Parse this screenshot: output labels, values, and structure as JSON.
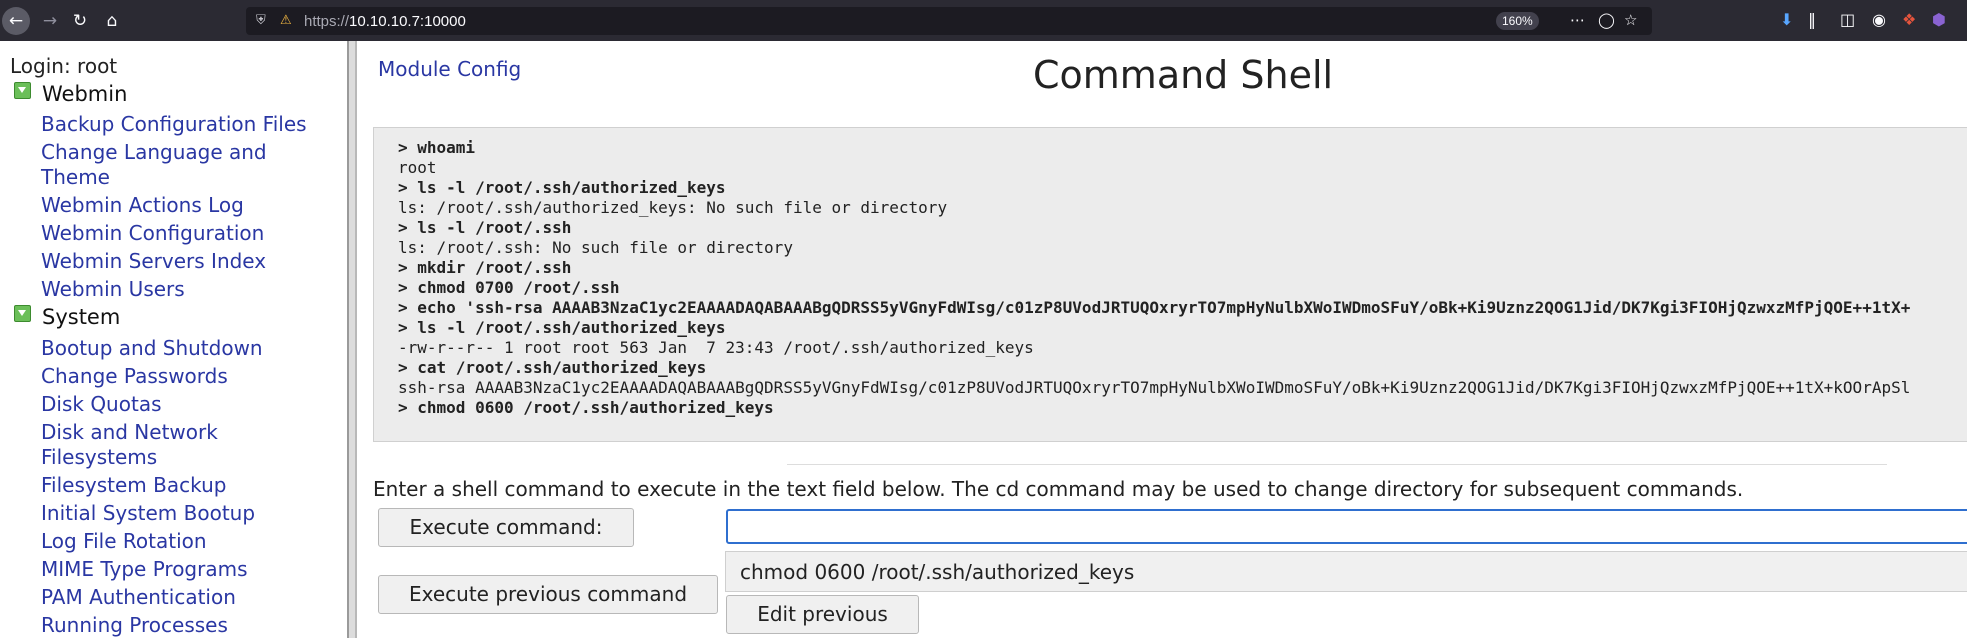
{
  "browser": {
    "url_protocol": "https://",
    "url_host": "10.10.10.7:10000",
    "zoom": "160%"
  },
  "left": {
    "login": "Login: root",
    "categories": [
      {
        "label": "Webmin",
        "items": [
          "Backup Configuration Files",
          "Change Language and Theme",
          "Webmin Actions Log",
          "Webmin Configuration",
          "Webmin Servers Index",
          "Webmin Users"
        ]
      },
      {
        "label": "System",
        "items": [
          "Bootup and Shutdown",
          "Change Passwords",
          "Disk Quotas",
          "Disk and Network Filesystems",
          "Filesystem Backup",
          "Initial System Bootup",
          "Log File Rotation",
          "MIME Type Programs",
          "PAM Authentication",
          "Running Processes"
        ]
      }
    ]
  },
  "main": {
    "module_config": "Module Config",
    "title": "Command Shell",
    "output_lines": [
      {
        "cmd": true,
        "text": "> whoami"
      },
      {
        "cmd": false,
        "text": "root"
      },
      {
        "cmd": true,
        "text": "> ls -l /root/.ssh/authorized_keys"
      },
      {
        "cmd": false,
        "text": "ls: /root/.ssh/authorized_keys: No such file or directory"
      },
      {
        "cmd": true,
        "text": "> ls -l /root/.ssh"
      },
      {
        "cmd": false,
        "text": "ls: /root/.ssh: No such file or directory"
      },
      {
        "cmd": true,
        "text": "> mkdir /root/.ssh"
      },
      {
        "cmd": true,
        "text": "> chmod 0700 /root/.ssh"
      },
      {
        "cmd": true,
        "text": "> echo 'ssh-rsa AAAAB3NzaC1yc2EAAAADAQABAAABgQDRSS5yVGnyFdWIsg/c01zP8UVodJRTUQOxryrTO7mpHyNulbXWoIWDmoSFuY/oBk+Ki9Uznz2QOG1Jid/DK7Kgi3FIOHjQzwxzMfPjQOE++1tX+"
      },
      {
        "cmd": true,
        "text": "> ls -l /root/.ssh/authorized_keys"
      },
      {
        "cmd": false,
        "text": "-rw-r--r-- 1 root root 563 Jan  7 23:43 /root/.ssh/authorized_keys"
      },
      {
        "cmd": true,
        "text": "> cat /root/.ssh/authorized_keys"
      },
      {
        "cmd": false,
        "text": "ssh-rsa AAAAB3NzaC1yc2EAAAADAQABAAABgQDRSS5yVGnyFdWIsg/c01zP8UVodJRTUQOxryrTO7mpHyNulbXWoIWDmoSFuY/oBk+Ki9Uznz2QOG1Jid/DK7Kgi3FIOHjQzwxzMfPjQOE++1tX+kOOrApSl"
      },
      {
        "cmd": true,
        "text": "> chmod 0600 /root/.ssh/authorized_keys"
      }
    ],
    "hint": "Enter a shell command to execute in the text field below. The cd command may be used to change directory for subsequent commands.",
    "execute_label": "Execute command:",
    "command_value": "",
    "execute_previous_label": "Execute previous command",
    "previous_command": "chmod 0600 /root/.ssh/authorized_keys",
    "edit_previous_label": "Edit previous"
  }
}
